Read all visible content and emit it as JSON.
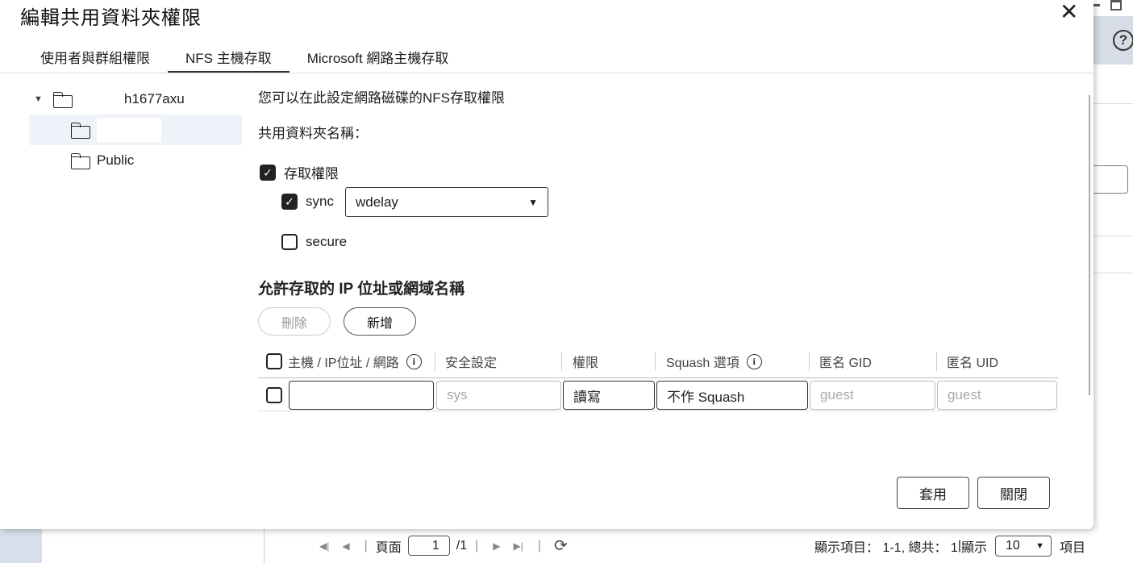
{
  "dialog": {
    "title": "編輯共用資料夾權限",
    "tabs": [
      {
        "label": "使用者與群組權限"
      },
      {
        "label": "NFS 主機存取"
      },
      {
        "label": "Microsoft 網路主機存取"
      }
    ],
    "active_tab": "NFS 主機存取"
  },
  "tree": {
    "root": "h1677axu",
    "items": [
      {
        "label": ""
      },
      {
        "label": "Public"
      }
    ]
  },
  "nfs": {
    "description": "您可以在此設定網路磁碟的NFS存取權限",
    "share_name_label": "共用資料夾名稱：",
    "access_label": "存取權限",
    "access_checked": true,
    "sync_label": "sync",
    "sync_checked": true,
    "sync_select_value": "wdelay",
    "secure_label": "secure",
    "secure_checked": false,
    "section_title": "允許存取的 IP 位址或網域名稱",
    "delete_button": "刪除",
    "add_button": "新增"
  },
  "table": {
    "headers": [
      "主機 / IP位址 / 網路",
      "安全設定",
      "權限",
      "Squash 選項",
      "匿名 GID",
      "匿名 UID"
    ],
    "row": {
      "host": "",
      "security_placeholder": "sys",
      "permission": "讀寫",
      "squash": "不作 Squash",
      "gid_placeholder": "guest",
      "uid_placeholder": "guest"
    }
  },
  "footer": {
    "apply": "套用",
    "close": "關閉"
  },
  "pager": {
    "page_label": "頁面",
    "page_value": "1",
    "total_pages": "/1",
    "display_items": "顯示項目： 1-1, 總共： 1",
    "show_label": "顯示",
    "per_page": "10",
    "items_label": "項目"
  }
}
